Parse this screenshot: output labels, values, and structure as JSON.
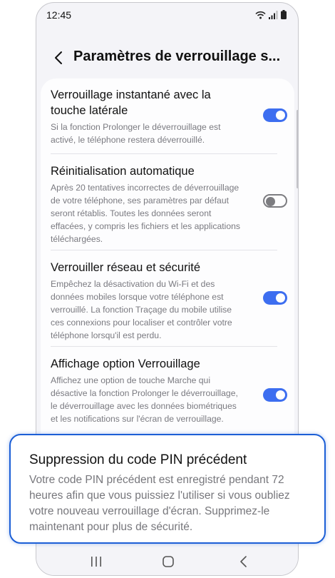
{
  "status_bar": {
    "time": "12:45"
  },
  "header": {
    "title": "Paramètres de verrouillage s..."
  },
  "settings": [
    {
      "title": "Verrouillage instantané avec la touche latérale",
      "description": "Si la fonction Prolonger le déverrouillage est activé, le téléphone restera déverrouillé.",
      "enabled": true
    },
    {
      "title": "Réinitialisation automatique",
      "description": "Après 20 tentatives incorrectes de déverrouillage de votre téléphone, ses paramètres par défaut seront rétablis. Toutes les données seront effacées, y compris les fichiers et les applications téléchargées.",
      "enabled": false
    },
    {
      "title": "Verrouiller réseau et sécurité",
      "description": "Empêchez la désactivation du Wi-Fi et des données mobiles lorsque votre téléphone est verrouillé. La fonction Traçage du mobile utilise ces connexions pour localiser et contrôler votre téléphone lorsqu'il est perdu.",
      "enabled": true
    },
    {
      "title": "Affichage option Verrouillage",
      "description": "Affichez une option de touche Marche qui désactive la fonction Prolonger le déverrouillage, le déverrouillage avec les données biométriques et les notifications sur l'écran de verrouillage.",
      "enabled": true
    }
  ],
  "callout": {
    "title": "Suppression du code PIN précédent",
    "description": "Votre code PIN précédent est enregistré pendant 72 heures afin que vous puissiez l'utiliser si vous oubliez votre nouveau verrouillage d'écran. Supprimez-le maintenant pour plus de sécurité."
  },
  "colors": {
    "toggle_on": "#3d6ef0",
    "callout_border": "#1c5fd6"
  },
  "icons": [
    "wifi-icon",
    "signal-icon",
    "battery-icon",
    "back-arrow-icon",
    "recent-apps-icon",
    "home-icon",
    "back-icon"
  ]
}
